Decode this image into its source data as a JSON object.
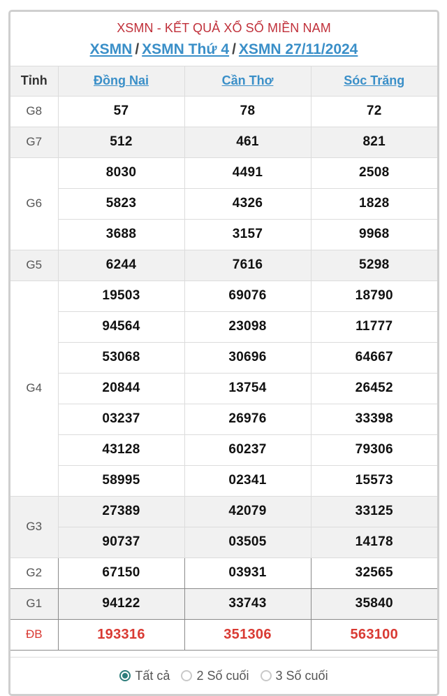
{
  "header": {
    "title": "XSMN - KẾT QUẢ XỔ SỐ MIỀN NAM",
    "breadcrumb": [
      {
        "label": "XSMN"
      },
      {
        "label": "XSMN Thứ 4"
      },
      {
        "label": "XSMN 27/11/2024"
      }
    ],
    "separator": "/"
  },
  "table": {
    "first_col_header": "Tỉnh",
    "provinces": [
      "Đồng Nai",
      "Cần Thơ",
      "Sóc Trăng"
    ],
    "prizes": [
      {
        "label": "G8",
        "rows": [
          [
            "57",
            "78",
            "72"
          ]
        ]
      },
      {
        "label": "G7",
        "rows": [
          [
            "512",
            "461",
            "821"
          ]
        ]
      },
      {
        "label": "G6",
        "rows": [
          [
            "8030",
            "4491",
            "2508"
          ],
          [
            "5823",
            "4326",
            "1828"
          ],
          [
            "3688",
            "3157",
            "9968"
          ]
        ]
      },
      {
        "label": "G5",
        "rows": [
          [
            "6244",
            "7616",
            "5298"
          ]
        ]
      },
      {
        "label": "G4",
        "rows": [
          [
            "19503",
            "69076",
            "18790"
          ],
          [
            "94564",
            "23098",
            "11777"
          ],
          [
            "53068",
            "30696",
            "64667"
          ],
          [
            "20844",
            "13754",
            "26452"
          ],
          [
            "03237",
            "26976",
            "33398"
          ],
          [
            "43128",
            "60237",
            "79306"
          ],
          [
            "58995",
            "02341",
            "15573"
          ]
        ]
      },
      {
        "label": "G3",
        "rows": [
          [
            "27389",
            "42079",
            "33125"
          ],
          [
            "90737",
            "03505",
            "14178"
          ]
        ]
      },
      {
        "label": "G2",
        "rows": [
          [
            "67150",
            "03931",
            "32565"
          ]
        ]
      },
      {
        "label": "G1",
        "rows": [
          [
            "94122",
            "33743",
            "35840"
          ]
        ]
      },
      {
        "label": "ĐB",
        "rows": [
          [
            "193316",
            "351306",
            "563100"
          ]
        ]
      }
    ]
  },
  "filter": {
    "options": [
      {
        "label": "Tất cả",
        "selected": true
      },
      {
        "label": "2 Số cuối",
        "selected": false
      },
      {
        "label": "3 Số cuối",
        "selected": false
      }
    ]
  },
  "colors": {
    "title_red": "#c0303a",
    "link_blue": "#3a8fc8",
    "special_prize_red": "#d93a33",
    "radio_teal": "#2e7d7b"
  }
}
